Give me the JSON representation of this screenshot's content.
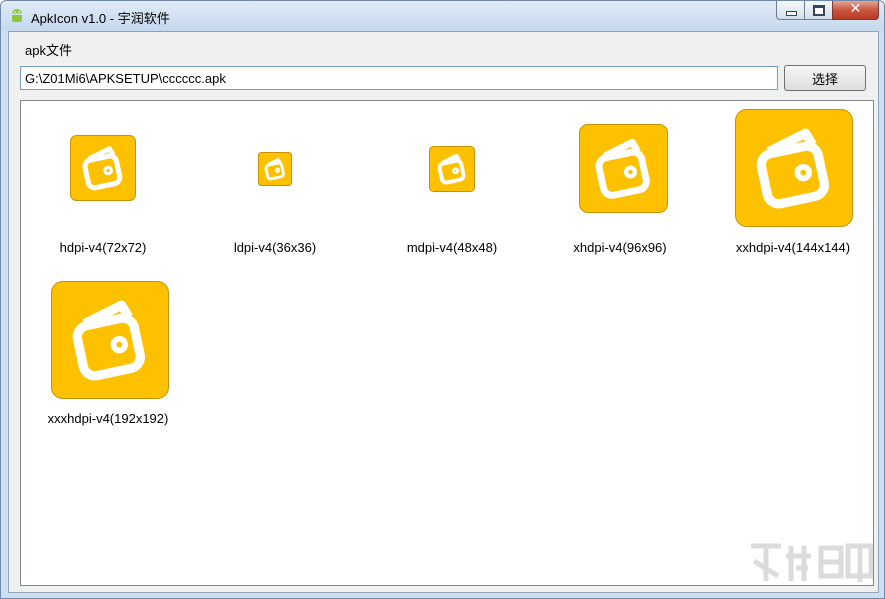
{
  "window": {
    "title": "ApkIcon v1.0 - 宇润软件",
    "close_glyph": "✕"
  },
  "form": {
    "group_label": "apk文件",
    "path_value": "G:\\Z01Mi6\\APKSETUP\\cccccc.apk",
    "browse_label": "选择"
  },
  "icons": [
    {
      "label": "hdpi-v4(72x72)"
    },
    {
      "label": "ldpi-v4(36x36)"
    },
    {
      "label": "mdpi-v4(48x48)"
    },
    {
      "label": "xhdpi-v4(96x96)"
    },
    {
      "label": "xxhdpi-v4(144x144)"
    },
    {
      "label": "xxxhdpi-v4(192x192)"
    }
  ],
  "colors": {
    "icon_background": "#fdc100",
    "title_gradient": "#c5d8ee"
  },
  "icon_names": {
    "app": "android-icon",
    "wallet": "wallet-icon",
    "watermark": "site-watermark-logo"
  }
}
